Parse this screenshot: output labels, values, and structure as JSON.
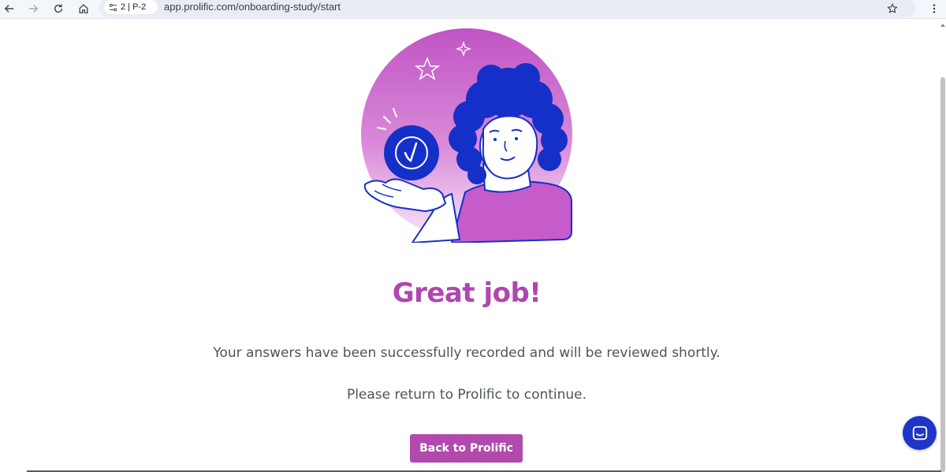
{
  "browser": {
    "tab_chip_label": "2 | P-2",
    "url": "app.prolific.com/onboarding-study/start"
  },
  "page": {
    "title": "Great job!",
    "message_recorded": "Your answers have been successfully recorded and will be reviewed shortly.",
    "message_return": "Please return to Prolific to continue.",
    "back_button_label": "Back to Prolific"
  },
  "icons": {
    "back": "arrow-left-icon",
    "forward": "arrow-right-icon",
    "reload": "reload-icon",
    "home": "home-icon",
    "site_settings": "tune-icon",
    "bookmark": "star-icon",
    "menu": "kebab-menu-icon",
    "chat": "chat-icon"
  },
  "colors": {
    "title": "#b046b0",
    "button": "#b24aae",
    "chat": "#1e35c7",
    "illustration_blue": "#1530c8",
    "illustration_purple": "#c55cc9"
  }
}
